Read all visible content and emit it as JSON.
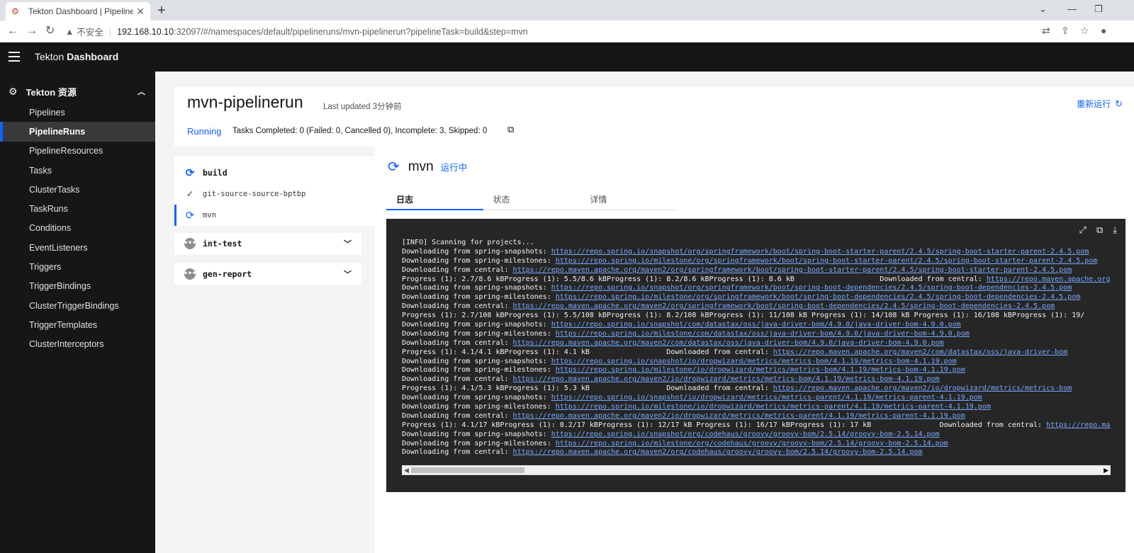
{
  "browser": {
    "tab_title": "Tekton Dashboard | PipelineRu",
    "insecure_label": "不安全",
    "url_host": "192.168.10.10",
    "url_path": ":32097/#/namespaces/default/pipelineruns/mvn-pipelinerun?pipelineTask=build&step=mvn"
  },
  "header": {
    "app_name_prefix": "Tekton ",
    "app_name_bold": "Dashboard"
  },
  "sidebar": {
    "group_label": "Tekton 资源",
    "items": [
      {
        "label": "Pipelines"
      },
      {
        "label": "PipelineRuns"
      },
      {
        "label": "PipelineResources"
      },
      {
        "label": "Tasks"
      },
      {
        "label": "ClusterTasks"
      },
      {
        "label": "TaskRuns"
      },
      {
        "label": "Conditions"
      },
      {
        "label": "EventListeners"
      },
      {
        "label": "Triggers"
      },
      {
        "label": "TriggerBindings"
      },
      {
        "label": "ClusterTriggerBindings"
      },
      {
        "label": "TriggerTemplates"
      },
      {
        "label": "ClusterInterceptors"
      }
    ]
  },
  "run": {
    "name": "mvn-pipelinerun",
    "last_updated": "Last updated 3分钟前",
    "rerun_label": "重新运行",
    "status": "Running",
    "summary": "Tasks Completed: 0 (Failed: 0, Cancelled 0), Incomplete: 3, Skipped: 0"
  },
  "tasks": {
    "open_task": "build",
    "steps": [
      "git-source-source-bptbp",
      "mvn"
    ],
    "collapsed": [
      "int-test",
      "gen-report"
    ]
  },
  "step": {
    "name": "mvn",
    "status": "运行中",
    "tabs": [
      "日志",
      "状态",
      "详情"
    ]
  },
  "log": {
    "lines": [
      {
        "text": "[INFO] Scanning for projects...",
        "link": ""
      },
      {
        "text": "Downloading from spring-snapshots: ",
        "link": "https://repo.spring.io/snapshot/org/springframework/boot/spring-boot-starter-parent/2.4.5/spring-boot-starter-parent-2.4.5.pom"
      },
      {
        "text": "Downloading from spring-milestones: ",
        "link": "https://repo.spring.io/milestone/org/springframework/boot/spring-boot-starter-parent/2.4.5/spring-boot-starter-parent-2.4.5.pom"
      },
      {
        "text": "Downloading from central: ",
        "link": "https://repo.maven.apache.org/maven2/org/springframework/boot/spring-boot-starter-parent/2.4.5/spring-boot-starter-parent-2.4.5.pom"
      },
      {
        "text": "Progress (1): 2.7/8.6 kBProgress (1): 5.5/8.6 kBProgress (1): 8.2/8.6 kBProgress (1): 8.6 kB                    Downloaded from central: ",
        "link": "https://repo.maven.apache.org"
      },
      {
        "text": "Downloading from spring-snapshots: ",
        "link": "https://repo.spring.io/snapshot/org/springframework/boot/spring-boot-dependencies/2.4.5/spring-boot-dependencies-2.4.5.pom"
      },
      {
        "text": "Downloading from spring-milestones: ",
        "link": "https://repo.spring.io/milestone/org/springframework/boot/spring-boot-dependencies/2.4.5/spring-boot-dependencies-2.4.5.pom"
      },
      {
        "text": "Downloading from central: ",
        "link": "https://repo.maven.apache.org/maven2/org/springframework/boot/spring-boot-dependencies/2.4.5/spring-boot-dependencies-2.4.5.pom"
      },
      {
        "text": "Progress (1): 2.7/108 kBProgress (1): 5.5/108 kBProgress (1): 8.2/108 kBProgress (1): 11/108 kB Progress (1): 14/108 kB Progress (1): 16/108 kBProgress (1): 19/",
        "link": ""
      },
      {
        "text": "Downloading from spring-snapshots: ",
        "link": "https://repo.spring.io/snapshot/com/datastax/oss/java-driver-bom/4.9.0/java-driver-bom-4.9.0.pom"
      },
      {
        "text": "Downloading from spring-milestones: ",
        "link": "https://repo.spring.io/milestone/com/datastax/oss/java-driver-bom/4.9.0/java-driver-bom-4.9.0.pom"
      },
      {
        "text": "Downloading from central: ",
        "link": "https://repo.maven.apache.org/maven2/com/datastax/oss/java-driver-bom/4.9.0/java-driver-bom-4.9.0.pom"
      },
      {
        "text": "Progress (1): 4.1/4.1 kBProgress (1): 4.1 kB                  Downloaded from central: ",
        "link": "https://repo.maven.apache.org/maven2/com/datastax/oss/java-driver-bom"
      },
      {
        "text": "Downloading from spring-snapshots: ",
        "link": "https://repo.spring.io/snapshot/io/dropwizard/metrics/metrics-bom/4.1.19/metrics-bom-4.1.19.pom"
      },
      {
        "text": "Downloading from spring-milestones: ",
        "link": "https://repo.spring.io/milestone/io/dropwizard/metrics/metrics-bom/4.1.19/metrics-bom-4.1.19.pom"
      },
      {
        "text": "Downloading from central: ",
        "link": "https://repo.maven.apache.org/maven2/io/dropwizard/metrics/metrics-bom/4.1.19/metrics-bom-4.1.19.pom"
      },
      {
        "text": "Progress (1): 4.1/5.3 kBProgress (1): 5.3 kB                  Downloaded from central: ",
        "link": "https://repo.maven.apache.org/maven2/io/dropwizard/metrics/metrics-bom"
      },
      {
        "text": "Downloading from spring-snapshots: ",
        "link": "https://repo.spring.io/snapshot/io/dropwizard/metrics/metrics-parent/4.1.19/metrics-parent-4.1.19.pom"
      },
      {
        "text": "Downloading from spring-milestones: ",
        "link": "https://repo.spring.io/milestone/io/dropwizard/metrics/metrics-parent/4.1.19/metrics-parent-4.1.19.pom"
      },
      {
        "text": "Downloading from central: ",
        "link": "https://repo.maven.apache.org/maven2/io/dropwizard/metrics/metrics-parent/4.1.19/metrics-parent-4.1.19.pom"
      },
      {
        "text": "Progress (1): 4.1/17 kBProgress (1): 8.2/17 kBProgress (1): 12/17 kB Progress (1): 16/17 kBProgress (1): 17 kB                Downloaded from central: ",
        "link": "https://repo.maven.apache.org"
      },
      {
        "text": "Downloading from spring-snapshots: ",
        "link": "https://repo.spring.io/snapshot/org/codehaus/groovy/groovy-bom/2.5.14/groovy-bom-2.5.14.pom"
      },
      {
        "text": "Downloading from spring-milestones: ",
        "link": "https://repo.spring.io/milestone/org/codehaus/groovy/groovy-bom/2.5.14/groovy-bom-2.5.14.pom"
      },
      {
        "text": "Downloading from central: ",
        "link": "https://repo.maven.apache.org/maven2/org/codehaus/groovy/groovy-bom/2.5.14/groovy-bom-2.5.14.pom"
      }
    ]
  },
  "colors": {
    "accent": "#0f62fe",
    "header_bg": "#161616",
    "log_bg": "#262626",
    "link": "#78a9ff"
  }
}
